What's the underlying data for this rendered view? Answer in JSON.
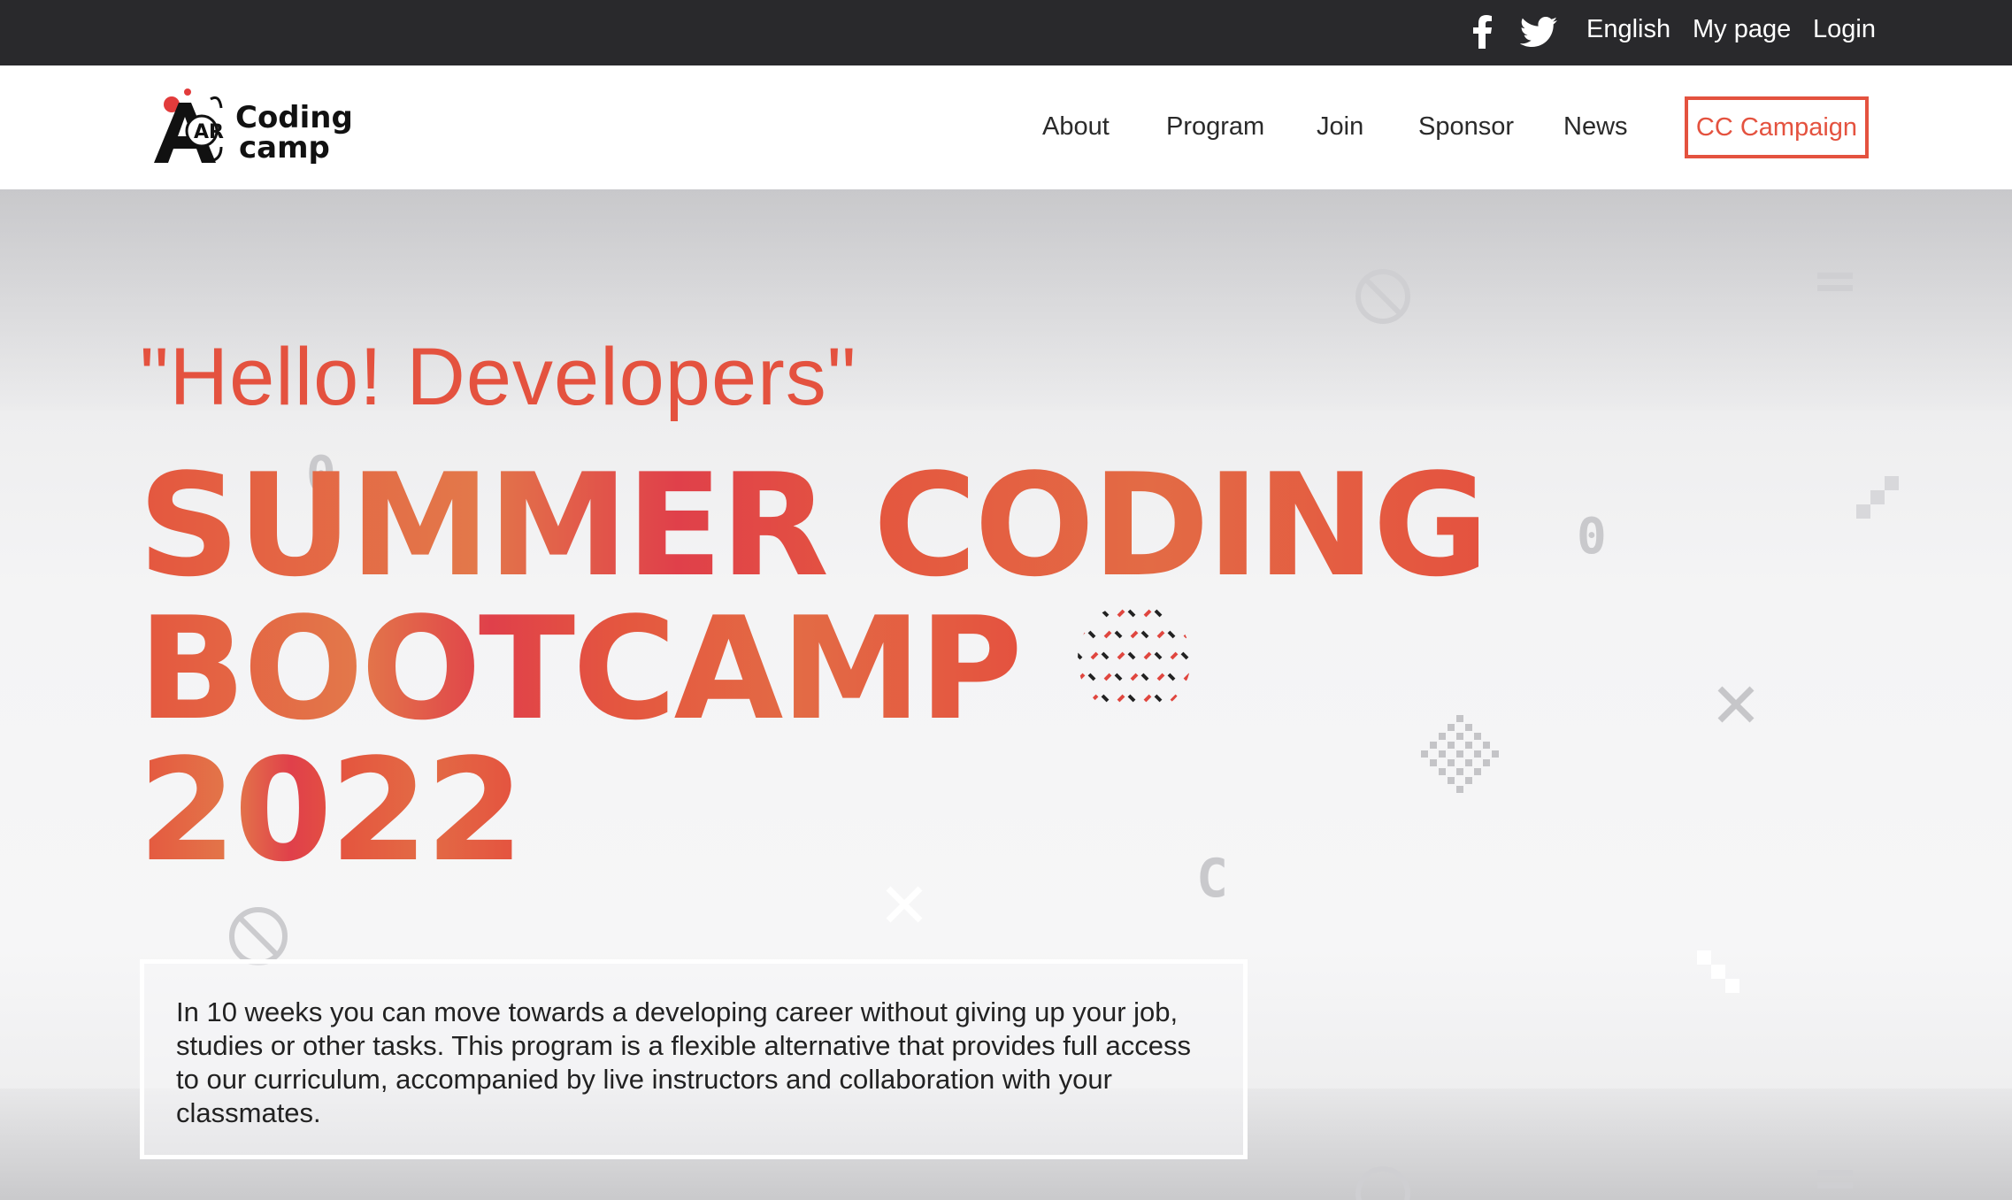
{
  "topbar": {
    "social": {
      "facebook_icon": "facebook-icon",
      "twitter_icon": "twitter-icon"
    },
    "language": "English",
    "my_page": "My page",
    "login": "Login"
  },
  "navbar": {
    "logo": {
      "mark": "AR",
      "line1": "Coding",
      "line2": "camp"
    },
    "links": {
      "about": "About",
      "program": "Program",
      "join": "Join",
      "sponsor": "Sponsor",
      "news": "News"
    },
    "cta": "CC Campaign"
  },
  "hero": {
    "greeting": "\"Hello! Developers\"",
    "headline_line1": "SUMMER CODING",
    "headline_line2": "BOOTCAMP",
    "headline_line3": "2022",
    "description": "In 10 weeks you can move towards a developing career without giving up your job, studies or other tasks. This program is a flexible alternative that provides full access to our curriculum, accompanied by live instructors and collaboration with your classmates.",
    "decorations": [
      "0",
      "0",
      "C"
    ]
  },
  "colors": {
    "topbar_bg": "#29292c",
    "accent": "#e4523f",
    "text": "#222222"
  }
}
